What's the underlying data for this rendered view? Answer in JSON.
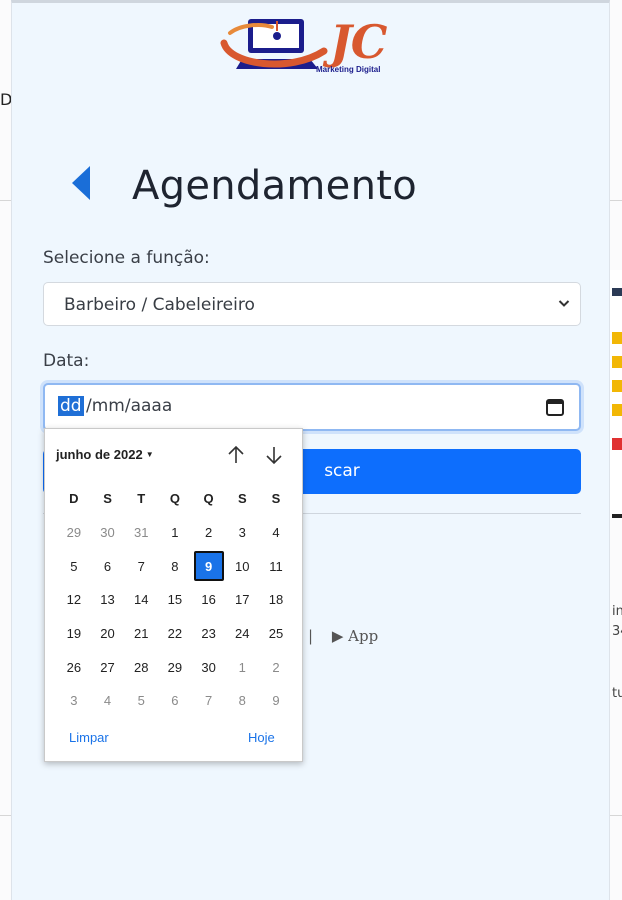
{
  "background": {
    "left_fragment": "D",
    "right_fragments": [
      "in",
      "34",
      "tu"
    ]
  },
  "logo": {
    "text": "JC",
    "subtitle": "Marketing Digital"
  },
  "header": {
    "title": "Agendamento"
  },
  "form": {
    "function_label": "Selecione a função:",
    "function_value": "Barbeiro / Cabeleireiro",
    "date_label": "Data:",
    "date_day_placeholder": "dd",
    "date_rest_placeholder": "/mm/aaaa",
    "search_button_label": "scar"
  },
  "links": {
    "separator": "|",
    "app_label": "▶ App"
  },
  "calendar": {
    "month_label": "junho de 2022",
    "weekdays": [
      "D",
      "S",
      "T",
      "Q",
      "Q",
      "S",
      "S"
    ],
    "weeks": [
      [
        "29",
        "30",
        "31",
        "1",
        "2",
        "3",
        "4"
      ],
      [
        "5",
        "6",
        "7",
        "8",
        "9",
        "10",
        "11"
      ],
      [
        "12",
        "13",
        "14",
        "15",
        "16",
        "17",
        "18"
      ],
      [
        "19",
        "20",
        "21",
        "22",
        "23",
        "24",
        "25"
      ],
      [
        "26",
        "27",
        "28",
        "29",
        "30",
        "1",
        "2"
      ],
      [
        "3",
        "4",
        "5",
        "6",
        "7",
        "8",
        "9"
      ]
    ],
    "selected_day": "9",
    "clear_label": "Limpar",
    "today_label": "Hoje"
  },
  "colors": {
    "accent": "#0d6efd",
    "panel_bg": "#eff7fe",
    "logo_orange": "#d8582f",
    "logo_navy": "#1b1d8c"
  }
}
